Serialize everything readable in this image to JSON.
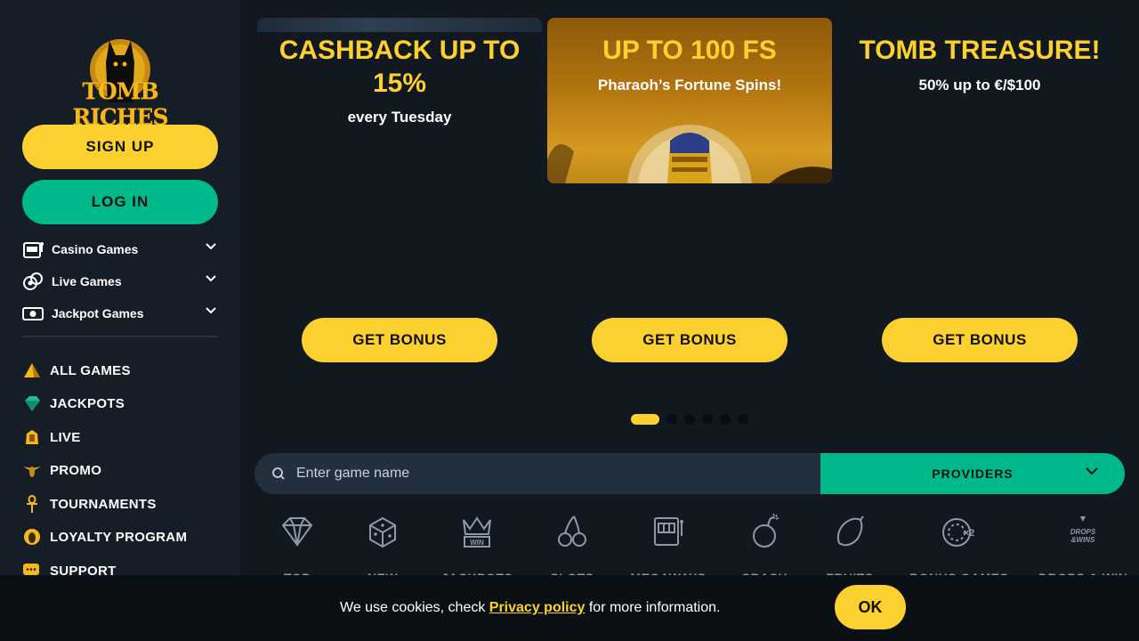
{
  "brand": {
    "logo_text": "TOMB RICHES"
  },
  "sidebar": {
    "signup_label": "SIGN UP",
    "login_label": "LOG IN",
    "categories": [
      {
        "label": "Casino Games",
        "icon": "slot-machine-icon"
      },
      {
        "label": "Live Games",
        "icon": "chips-icon"
      },
      {
        "label": "Jackpot Games",
        "icon": "cash-icon"
      }
    ],
    "nav": [
      {
        "label": "ALL GAMES",
        "icon": "pyramid-icon"
      },
      {
        "label": "JACKPOTS",
        "icon": "gem-icon"
      },
      {
        "label": "LIVE",
        "icon": "pharaoh-icon"
      },
      {
        "label": "PROMO",
        "icon": "winged-scarab-icon"
      },
      {
        "label": "TOURNAMENTS",
        "icon": "ankh-icon"
      },
      {
        "label": "LOYALTY PROGRAM",
        "icon": "scarab-icon"
      },
      {
        "label": "SUPPORT",
        "icon": "chat-icon"
      }
    ]
  },
  "promos": [
    {
      "title": "CASHBACK UP TO 15%",
      "subtitle": "every Tuesday",
      "button": "GET BONUS"
    },
    {
      "title": "UP TO 100 FS",
      "subtitle": "Pharaoh’s Fortune Spins!",
      "button": "GET BONUS"
    },
    {
      "title": "TOMB TREASURE!",
      "subtitle": "50% up to €/$100",
      "button": "GET BONUS"
    }
  ],
  "carousel": {
    "total_slides": 6,
    "active_index": 0
  },
  "search": {
    "placeholder": "Enter game name",
    "providers_label": "PROVIDERS"
  },
  "game_categories": [
    {
      "label": "TOP",
      "icon": "diamond-icon"
    },
    {
      "label": "NEW",
      "icon": "dice-icon"
    },
    {
      "label": "JACKPOTS",
      "icon": "crown-win-icon"
    },
    {
      "label": "SLOTS",
      "icon": "cherries-icon"
    },
    {
      "label": "MEGAWAYS",
      "icon": "slot-machine-icon"
    },
    {
      "label": "CRASH",
      "icon": "bomb-icon"
    },
    {
      "label": "FRUITS",
      "icon": "lemon-icon"
    },
    {
      "label": "BONUS GAMES",
      "icon": "coin-x2-icon"
    },
    {
      "label": "DROPS & WIN",
      "icon": "drops-wins-icon"
    }
  ],
  "cookie": {
    "text_before": "We use cookies, check ",
    "link": "Privacy policy",
    "text_after": " for more information.",
    "ok_label": "OK"
  },
  "colors": {
    "accent_yellow": "#fcd02e",
    "accent_green": "#00b98a",
    "background": "#111820",
    "sidebar": "#151d26"
  }
}
